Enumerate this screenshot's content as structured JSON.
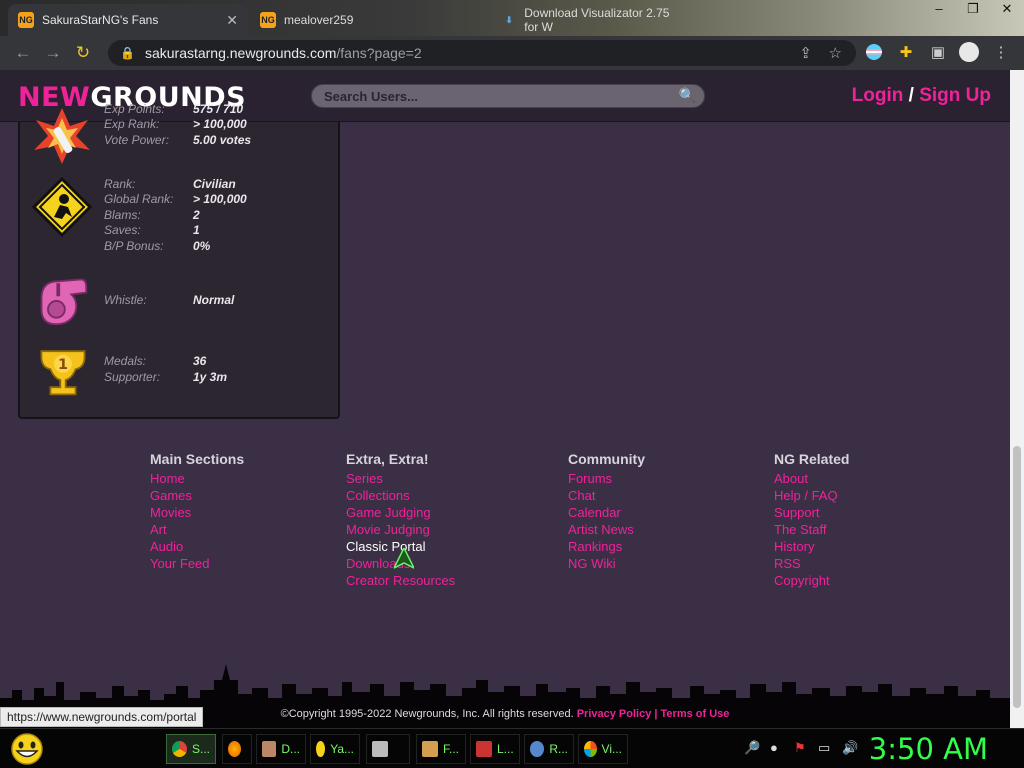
{
  "browser": {
    "tabs": [
      {
        "title": "SakuraStarNG's Fans",
        "active": true
      },
      {
        "title": "mealover259",
        "active": false
      },
      {
        "title": "Download Visualizator 2.75 for W",
        "active": false
      }
    ],
    "url_domain": "sakurastarng.newgrounds.com",
    "url_path": "/fans?page=2",
    "window_buttons": [
      "–",
      "❐",
      "✕"
    ]
  },
  "header": {
    "logo_new": "NEW",
    "logo_grounds": "GROUNDS",
    "search_placeholder": "Search Users...",
    "login": "Login",
    "separator": "/",
    "signup": "Sign Up"
  },
  "stats": {
    "level": [
      {
        "k": "Exp Points:",
        "v": "575 / 710"
      },
      {
        "k": "Exp Rank:",
        "v": "> 100,000"
      },
      {
        "k": "Vote Power:",
        "v": "5.00 votes"
      }
    ],
    "rank": [
      {
        "k": "Rank:",
        "v": "Civilian"
      },
      {
        "k": "Global Rank:",
        "v": "> 100,000"
      },
      {
        "k": "Blams:",
        "v": "2"
      },
      {
        "k": "Saves:",
        "v": "1"
      },
      {
        "k": "B/P Bonus:",
        "v": "0%"
      }
    ],
    "whistle": [
      {
        "k": "Whistle:",
        "v": "Normal"
      }
    ],
    "medals": [
      {
        "k": "Medals:",
        "v": "36"
      },
      {
        "k": "Supporter:",
        "v": "1y 3m"
      }
    ],
    "trophy_number": "1"
  },
  "footer": {
    "columns": [
      {
        "title": "Main Sections",
        "links": [
          "Home",
          "Games",
          "Movies",
          "Art",
          "Audio",
          "Your Feed"
        ]
      },
      {
        "title": "Extra, Extra!",
        "links": [
          "Series",
          "Collections",
          "Game Judging",
          "Movie Judging",
          "Classic Portal",
          "Downloads",
          "Creator Resources"
        ]
      },
      {
        "title": "Community",
        "links": [
          "Forums",
          "Chat",
          "Calendar",
          "Artist News",
          "Rankings",
          "NG Wiki"
        ]
      },
      {
        "title": "NG Related",
        "links": [
          "About",
          "Help / FAQ",
          "Support",
          "The Staff",
          "History",
          "RSS",
          "Copyright"
        ]
      }
    ],
    "hovered_link": "Classic Portal",
    "copyright": "©Copyright 1995-2022 Newgrounds, Inc. All rights reserved.",
    "privacy": "Privacy Policy",
    "pipe": "|",
    "terms": "Terms of Use"
  },
  "status_url": "https://www.newgrounds.com/portal",
  "taskbar": {
    "items": [
      "S...",
      "",
      "D...",
      "Ya...",
      "",
      "F...",
      "L...",
      "R...",
      "Vi..."
    ],
    "clock": "3:50 AM"
  },
  "colors": {
    "accent": "#f0229a",
    "page_bg": "#3a2f44",
    "clock": "#2fff4a"
  }
}
